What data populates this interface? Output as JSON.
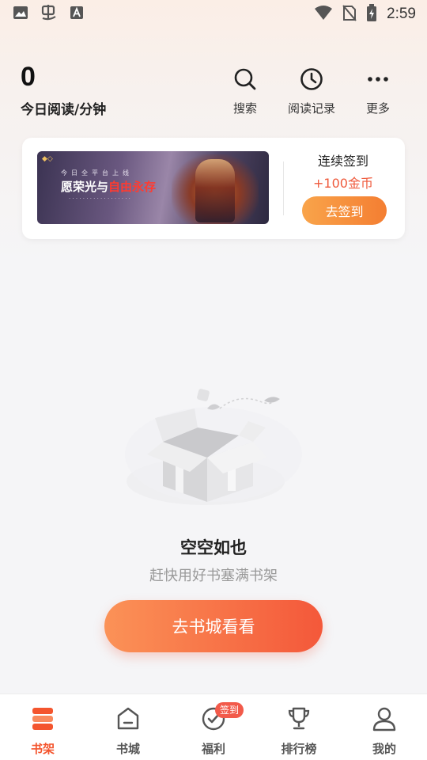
{
  "status_bar": {
    "time": "2:59",
    "left_icons": [
      "image-icon",
      "bug-icon",
      "font-icon"
    ],
    "right_icons": [
      "wifi-icon",
      "no-sim-icon",
      "battery-charging-icon"
    ]
  },
  "header": {
    "reading_minutes": "0",
    "reading_label": "今日阅读/分钟",
    "actions": [
      {
        "label": "搜索",
        "icon": "search-icon"
      },
      {
        "label": "阅读记录",
        "icon": "clock-icon"
      },
      {
        "label": "更多",
        "icon": "more-icon"
      }
    ]
  },
  "signin_card": {
    "banner": {
      "top_text": "今日全平台上线",
      "title_main": "愿荣光与",
      "title_highlight": "自由永存"
    },
    "title": "连续签到",
    "reward": "+100金币",
    "button_label": "去签到"
  },
  "empty_state": {
    "title": "空空如也",
    "subtitle": "赶快用好书塞满书架",
    "button_label": "去书城看看"
  },
  "bottom_nav": {
    "items": [
      {
        "label": "书架",
        "icon": "bookshelf-icon",
        "active": true
      },
      {
        "label": "书城",
        "icon": "bookstore-icon",
        "active": false
      },
      {
        "label": "福利",
        "icon": "welfare-icon",
        "active": false,
        "badge": "签到"
      },
      {
        "label": "排行榜",
        "icon": "trophy-icon",
        "active": false
      },
      {
        "label": "我的",
        "icon": "profile-icon",
        "active": false
      }
    ]
  },
  "colors": {
    "accent": "#f4552e",
    "reward": "#ef5a3c",
    "badge": "#f25a4a"
  }
}
